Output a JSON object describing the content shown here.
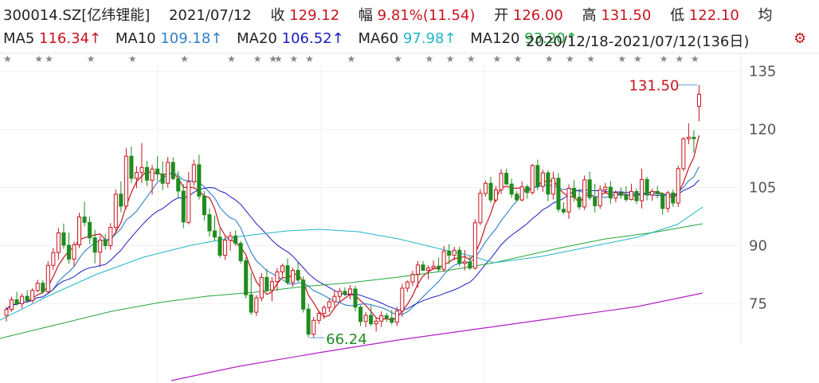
{
  "header": {
    "stock": "300014.SZ[亿纬锂能]",
    "date": "2021/07/12",
    "close_label": "收",
    "close": "129.12",
    "change_label": "幅",
    "change": "9.81%(11.54)",
    "open_label": "开",
    "open": "126.00",
    "high_label": "高",
    "high": "131.50",
    "low_label": "低",
    "low": "122.10",
    "avg_label": "均"
  },
  "ma_legend": [
    {
      "label": "MA5",
      "value": "116.34↑",
      "color": "#c8141e"
    },
    {
      "label": "MA10",
      "value": "109.18↑",
      "color": "#2f7fc9"
    },
    {
      "label": "MA20",
      "value": "106.52↑",
      "color": "#1c1cc0"
    },
    {
      "label": "MA60",
      "value": "97.98↑",
      "color": "#20b6c8"
    },
    {
      "label": "MA120",
      "value": "93.20↑",
      "color": "#22a63a"
    }
  ],
  "range_text": "2020/12/18-2021/07/12(136日)",
  "gear_icon": "gear-icon",
  "chart_data": {
    "type": "candlestick",
    "ylim": [
      65,
      137
    ],
    "yticks": [
      135,
      120,
      105,
      90,
      75
    ],
    "up_color": "#c8141e",
    "down_color": "#1e8c1e",
    "annotations": {
      "high": "131.50",
      "low": "66.24"
    },
    "candles": [
      [
        72.0,
        74.2,
        70.4,
        73.5
      ],
      [
        73.5,
        76.8,
        72.9,
        76.0
      ],
      [
        76.0,
        78.1,
        74.6,
        75.0
      ],
      [
        75.0,
        77.6,
        73.8,
        76.9
      ],
      [
        76.9,
        78.5,
        75.6,
        75.8
      ],
      [
        75.8,
        79.0,
        75.2,
        78.4
      ],
      [
        78.4,
        81.2,
        77.9,
        80.3
      ],
      [
        80.3,
        81.0,
        77.5,
        78.1
      ],
      [
        78.1,
        86.0,
        77.6,
        84.9
      ],
      [
        84.9,
        89.4,
        83.7,
        88.2
      ],
      [
        88.2,
        94.6,
        86.4,
        93.3
      ],
      [
        93.3,
        95.7,
        89.2,
        90.1
      ],
      [
        90.1,
        93.4,
        85.3,
        86.5
      ],
      [
        86.5,
        91.0,
        84.6,
        90.2
      ],
      [
        90.2,
        98.5,
        89.4,
        97.4
      ],
      [
        97.4,
        101.3,
        95.0,
        96.0
      ],
      [
        96.0,
        97.5,
        90.4,
        92.0
      ],
      [
        92.0,
        94.1,
        85.4,
        88.3
      ],
      [
        88.3,
        92.5,
        84.5,
        91.4
      ],
      [
        91.4,
        93.0,
        89.0,
        90.0
      ],
      [
        90.0,
        95.8,
        88.9,
        94.7
      ],
      [
        94.7,
        104.5,
        93.5,
        103.3
      ],
      [
        103.3,
        106.6,
        98.6,
        100.2
      ],
      [
        100.2,
        115.2,
        99.5,
        113.1
      ],
      [
        113.1,
        115.6,
        106.1,
        107.4
      ],
      [
        107.4,
        110.5,
        104.8,
        108.9
      ],
      [
        108.9,
        116.5,
        106.2,
        110.2
      ],
      [
        110.2,
        111.9,
        105.4,
        106.9
      ],
      [
        106.9,
        110.8,
        103.2,
        109.8
      ],
      [
        109.8,
        113.1,
        106.7,
        108.5
      ],
      [
        108.5,
        111.8,
        104.3,
        106.1
      ],
      [
        106.1,
        112.9,
        105.0,
        111.5
      ],
      [
        111.5,
        112.8,
        106.9,
        107.3
      ],
      [
        107.3,
        109.2,
        102.5,
        104.1
      ],
      [
        104.1,
        105.9,
        94.5,
        96.1
      ],
      [
        96.0,
        109.0,
        95.5,
        106.5
      ],
      [
        106.5,
        112.2,
        105.4,
        110.9
      ],
      [
        110.9,
        113.5,
        101.9,
        102.8
      ],
      [
        102.8,
        104.1,
        96.5,
        98.0
      ],
      [
        98.0,
        99.6,
        92.3,
        93.8
      ],
      [
        93.8,
        97.8,
        91.2,
        92.2
      ],
      [
        92.2,
        94.5,
        86.8,
        87.5
      ],
      [
        87.5,
        92.4,
        86.3,
        91.4
      ],
      [
        91.4,
        93.6,
        88.7,
        92.5
      ],
      [
        92.5,
        94.0,
        89.9,
        90.6
      ],
      [
        90.6,
        91.2,
        85.4,
        86.1
      ],
      [
        86.1,
        87.0,
        76.4,
        77.3
      ],
      [
        77.3,
        83.0,
        72.1,
        72.8
      ],
      [
        72.8,
        77.2,
        71.8,
        76.5
      ],
      [
        76.5,
        82.9,
        75.6,
        81.8
      ],
      [
        81.8,
        84.0,
        77.9,
        78.5
      ],
      [
        78.5,
        81.9,
        75.6,
        80.7
      ],
      [
        80.7,
        84.2,
        78.3,
        83.2
      ],
      [
        83.2,
        85.3,
        82.0,
        84.8
      ],
      [
        84.8,
        86.7,
        79.9,
        80.5
      ],
      [
        80.5,
        84.3,
        79.4,
        83.6
      ],
      [
        83.6,
        85.8,
        80.6,
        81.1
      ],
      [
        81.1,
        82.1,
        72.7,
        73.6
      ],
      [
        73.6,
        75.0,
        66.2,
        67.1
      ],
      [
        67.1,
        71.5,
        66.3,
        70.7
      ],
      [
        70.7,
        73.2,
        69.7,
        72.5
      ],
      [
        72.5,
        74.6,
        71.0,
        74.0
      ],
      [
        74.0,
        76.3,
        72.8,
        75.5
      ],
      [
        75.5,
        78.4,
        73.8,
        76.9
      ],
      [
        76.9,
        79.1,
        75.3,
        78.2
      ],
      [
        78.2,
        79.2,
        76.9,
        77.5
      ],
      [
        77.5,
        79.8,
        76.1,
        78.8
      ],
      [
        78.8,
        79.6,
        73.0,
        74.1
      ],
      [
        74.1,
        74.6,
        69.2,
        70.4
      ],
      [
        70.4,
        72.8,
        68.9,
        72.0
      ],
      [
        72.0,
        74.5,
        69.3,
        69.8
      ],
      [
        69.8,
        71.4,
        67.8,
        70.5
      ],
      [
        70.5,
        73.0,
        69.0,
        71.9
      ],
      [
        71.9,
        72.6,
        70.3,
        71.3
      ],
      [
        71.3,
        73.4,
        69.6,
        70.2
      ],
      [
        70.2,
        74.2,
        69.2,
        73.1
      ],
      [
        73.1,
        80.1,
        71.6,
        79.0
      ],
      [
        79.0,
        81.0,
        78.0,
        80.6
      ],
      [
        80.6,
        83.5,
        79.6,
        82.6
      ],
      [
        82.6,
        86.0,
        79.1,
        85.0
      ],
      [
        85.0,
        86.0,
        83.6,
        83.6
      ],
      [
        83.6,
        84.9,
        81.3,
        84.2
      ],
      [
        84.2,
        86.2,
        84.0,
        84.7
      ],
      [
        84.7,
        86.9,
        83.3,
        83.9
      ],
      [
        83.9,
        89.9,
        83.2,
        88.5
      ],
      [
        88.5,
        90.4,
        85.2,
        87.5
      ],
      [
        87.5,
        89.7,
        86.2,
        88.8
      ],
      [
        88.8,
        89.7,
        84.6,
        85.4
      ],
      [
        85.4,
        88.9,
        83.6,
        85.8
      ],
      [
        85.8,
        87.4,
        83.7,
        84.2
      ],
      [
        84.2,
        96.8,
        83.8,
        95.9
      ],
      [
        95.9,
        104.6,
        95.3,
        103.5
      ],
      [
        103.5,
        106.8,
        102.7,
        106.1
      ],
      [
        106.1,
        107.8,
        101.0,
        101.8
      ],
      [
        101.8,
        105.4,
        101.2,
        104.4
      ],
      [
        104.4,
        109.8,
        103.3,
        108.7
      ],
      [
        108.7,
        109.9,
        105.8,
        105.9
      ],
      [
        105.9,
        107.3,
        102.3,
        103.3
      ],
      [
        103.3,
        104.1,
        101.3,
        101.8
      ],
      [
        101.8,
        106.6,
        101.4,
        105.2
      ],
      [
        105.2,
        105.8,
        102.1,
        103.7
      ],
      [
        103.7,
        111.1,
        103.2,
        110.7
      ],
      [
        110.7,
        112.2,
        104.3,
        105.3
      ],
      [
        105.3,
        109.6,
        103.9,
        108.8
      ],
      [
        108.8,
        109.5,
        101.5,
        103.3
      ],
      [
        103.3,
        109.1,
        101.9,
        107.4
      ],
      [
        107.4,
        108.7,
        98.6,
        99.4
      ],
      [
        99.4,
        101.2,
        98.2,
        98.7
      ],
      [
        98.7,
        105.8,
        96.9,
        104.8
      ],
      [
        104.8,
        106.9,
        101.4,
        102.5
      ],
      [
        102.5,
        104.7,
        99.3,
        100.0
      ],
      [
        100.0,
        108.1,
        99.2,
        107.0
      ],
      [
        107.0,
        109.1,
        101.7,
        102.4
      ],
      [
        102.4,
        106.0,
        98.6,
        100.3
      ],
      [
        100.3,
        105.6,
        99.5,
        104.4
      ],
      [
        104.4,
        106.2,
        103.3,
        105.1
      ],
      [
        105.1,
        106.7,
        100.8,
        102.3
      ],
      [
        102.3,
        104.3,
        101.2,
        103.7
      ],
      [
        103.7,
        105.0,
        102.1,
        103.0
      ],
      [
        103.0,
        105.3,
        101.3,
        101.9
      ],
      [
        101.9,
        106.0,
        101.7,
        104.0
      ],
      [
        104.0,
        104.8,
        100.8,
        101.6
      ],
      [
        101.6,
        109.9,
        99.6,
        107.1
      ],
      [
        107.1,
        107.8,
        101.7,
        103.1
      ],
      [
        103.1,
        104.7,
        101.6,
        104.0
      ],
      [
        104.0,
        105.4,
        102.2,
        103.4
      ],
      [
        103.4,
        103.8,
        98.0,
        99.6
      ],
      [
        99.6,
        104.2,
        98.6,
        103.6
      ],
      [
        103.6,
        104.5,
        100.0,
        101.0
      ],
      [
        101.0,
        110.6,
        100.0,
        109.9
      ],
      [
        109.9,
        118.0,
        109.2,
        117.6
      ],
      [
        117.6,
        121.6,
        116.2,
        118.0
      ],
      [
        118.0,
        119.8,
        114.1,
        117.6
      ],
      [
        126.0,
        131.5,
        122.1,
        129.12
      ]
    ]
  }
}
